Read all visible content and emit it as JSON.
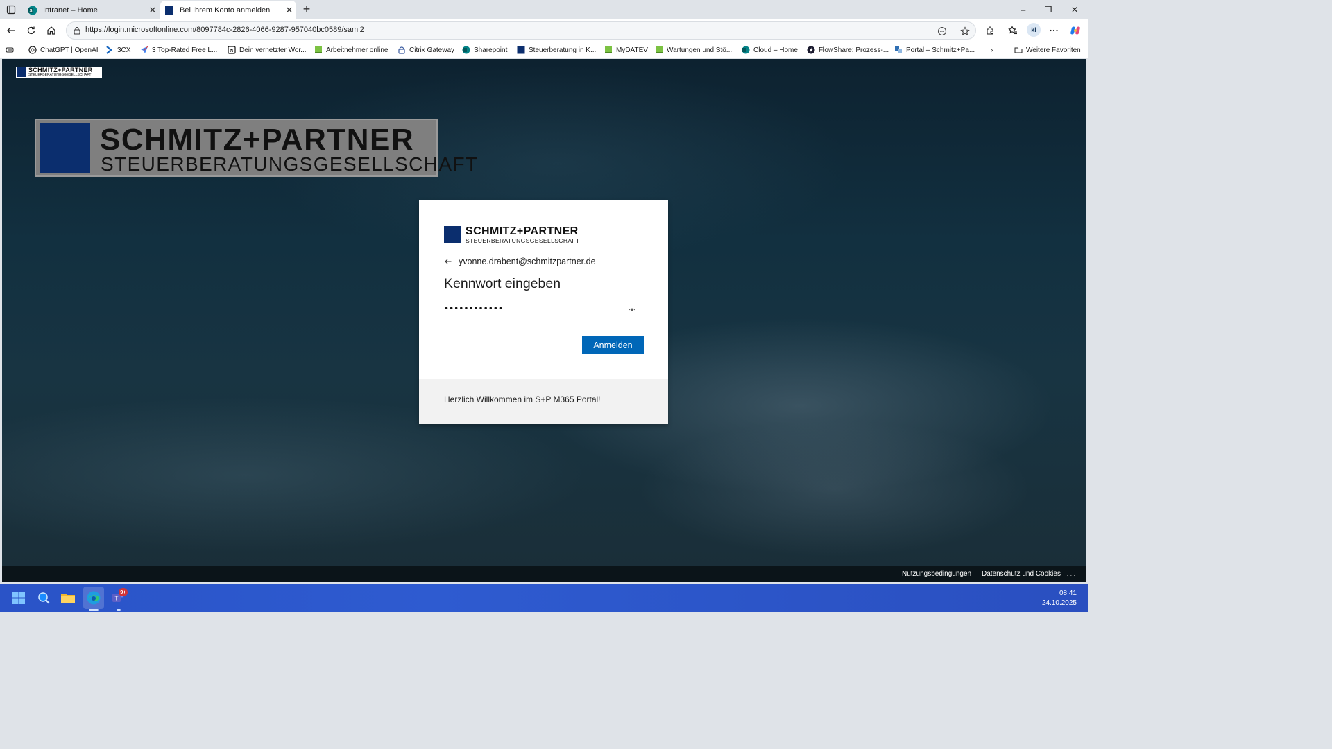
{
  "browser": {
    "tabs": [
      {
        "title": "Intranet – Home",
        "close": "✕"
      },
      {
        "title": "Bei Ihrem Konto anmelden",
        "close": "✕"
      }
    ],
    "new_tab": "+",
    "window_controls": {
      "minimize": "–",
      "restore": "❐",
      "close": "✕"
    },
    "url": "https://login.microsoftonline.com/8097784c-2826-4066-9287-957040bc0589/saml2",
    "profile_initials": "kl"
  },
  "favorites": {
    "items": [
      {
        "label": "ChatGPT | OpenAI",
        "icon": "openai-icon"
      },
      {
        "label": "3CX",
        "icon": "3cx-icon"
      },
      {
        "label": "3 Top-Rated Free L...",
        "icon": "arrow-icon"
      },
      {
        "label": "Dein vernetzter Wor...",
        "icon": "notion-icon"
      },
      {
        "label": "Arbeitnehmer online",
        "icon": "datev-icon"
      },
      {
        "label": "Citrix Gateway",
        "icon": "citrix-icon"
      },
      {
        "label": "Sharepoint",
        "icon": "sharepoint-icon"
      },
      {
        "label": "Steuerberatung in K...",
        "icon": "sp-logo-icon"
      },
      {
        "label": "MyDATEV",
        "icon": "datev-icon"
      },
      {
        "label": "Wartungen und Stö...",
        "icon": "datev-icon"
      },
      {
        "label": "Cloud – Home",
        "icon": "sharepoint-icon"
      },
      {
        "label": "FlowShare: Prozess-...",
        "icon": "flowshare-icon"
      },
      {
        "label": "Portal – Schmitz+Pa...",
        "icon": "portal-icon"
      }
    ],
    "overflow": "›",
    "other_favorites": "Weitere Favoriten"
  },
  "brand": {
    "name": "SCHMITZ+PARTNER",
    "tagline": "STEUERBERATUNGSGESELLSCHAFT"
  },
  "login": {
    "email": "yvonne.drabent@schmitzpartner.de",
    "heading": "Kennwort eingeben",
    "password_mask": "••••••••••••",
    "signin_button": "Anmelden",
    "welcome": "Herzlich Willkommen im S+P M365 Portal!"
  },
  "footer": {
    "terms": "Nutzungsbedingungen",
    "privacy": "Datenschutz und Cookies",
    "more": "..."
  },
  "taskbar": {
    "teams_badge": "9+",
    "time": "08:41",
    "date": "24.10.2025"
  },
  "colors": {
    "accent": "#0067b8",
    "brand_blue": "#0b2e6e",
    "taskbar": "#2e5bd0"
  }
}
